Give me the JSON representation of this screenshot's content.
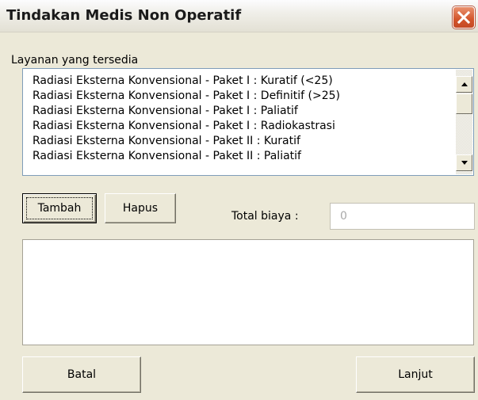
{
  "window": {
    "title": "Tindakan Medis Non Operatif"
  },
  "services": {
    "label": "Layanan yang tersedia",
    "items": [
      "Radiasi Eksterna Konvensional - Paket I : Kuratif (<25)",
      "Radiasi Eksterna Konvensional - Paket I : Definitif (>25)",
      "Radiasi Eksterna Konvensional - Paket I : Paliatif",
      "Radiasi Eksterna Konvensional - Paket I : Radiokastrasi",
      "Radiasi Eksterna Konvensional - Paket II : Kuratif",
      "Radiasi Eksterna Konvensional - Paket II : Paliatif"
    ]
  },
  "actions": {
    "add_label": "Tambah",
    "remove_label": "Hapus"
  },
  "total": {
    "label": "Total biaya :",
    "value": "0"
  },
  "footer": {
    "cancel_label": "Batal",
    "next_label": "Lanjut"
  },
  "colors": {
    "face": "#ece9d8",
    "close": "#d3542a"
  }
}
